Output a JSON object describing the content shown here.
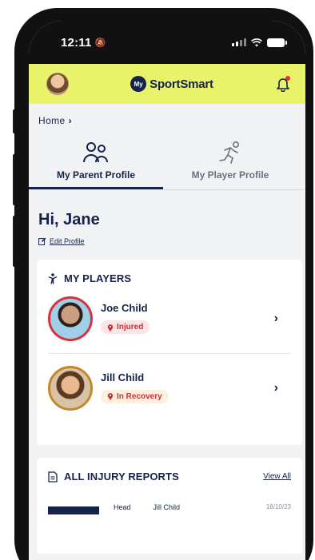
{
  "status_bar": {
    "time": "12:11"
  },
  "app": {
    "brand_badge": "My",
    "brand_name": "SportSmart"
  },
  "breadcrumb": {
    "home": "Home"
  },
  "tabs": [
    {
      "label": "My Parent Profile",
      "active": true
    },
    {
      "label": "My Player Profile",
      "active": false
    }
  ],
  "greeting": "Hi, Jane",
  "edit_profile": "Edit Profile",
  "players": {
    "title": "MY PLAYERS",
    "items": [
      {
        "name": "Joe Child",
        "status": "Injured"
      },
      {
        "name": "Jill Child",
        "status": "In Recovery"
      }
    ]
  },
  "reports": {
    "title": "ALL INJURY REPORTS",
    "view_all": "View All",
    "rows": [
      {
        "type": "Head",
        "player": "Jill Child",
        "date": "18/10/23"
      }
    ]
  },
  "colors": {
    "header_bg": "#e9f36a",
    "navy": "#15224a",
    "injured_red": "#c8303c",
    "screen_bg": "#f1f2f4"
  }
}
